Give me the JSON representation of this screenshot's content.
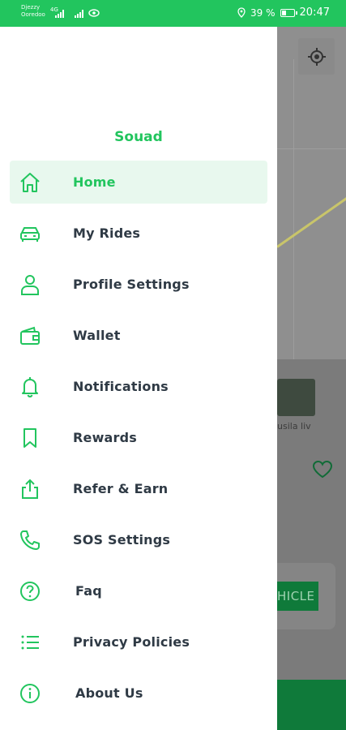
{
  "status_bar": {
    "carrier_line1": "Djezzy",
    "carrier_line2": "Ooredoo",
    "signal_label": "4G",
    "battery_text": "39 %",
    "battery_level": 0.39,
    "time": "20:47"
  },
  "colors": {
    "accent": "#22c55e",
    "active_bg": "#e8f8ee",
    "label_text": "#2f3a45",
    "dark_green": "#0f7a3a"
  },
  "drawer": {
    "user_name": "Souad",
    "items": [
      {
        "label": "Home",
        "icon": "home-icon",
        "active": true
      },
      {
        "label": "My Rides",
        "icon": "car-icon",
        "active": false
      },
      {
        "label": "Profile Settings",
        "icon": "user-icon",
        "active": false
      },
      {
        "label": "Wallet",
        "icon": "wallet-icon",
        "active": false
      },
      {
        "label": "Notifications",
        "icon": "bell-icon",
        "active": false
      },
      {
        "label": "Rewards",
        "icon": "bookmark-icon",
        "active": false
      },
      {
        "label": "Refer & Earn",
        "icon": "share-icon",
        "active": false
      },
      {
        "label": "SOS Settings",
        "icon": "phone-icon",
        "active": false
      },
      {
        "label": "Faq",
        "icon": "help-circle-icon",
        "active": false
      },
      {
        "label": "Privacy Policies",
        "icon": "list-icon",
        "active": false
      },
      {
        "label": "About Us",
        "icon": "info-icon",
        "active": false
      }
    ]
  },
  "background": {
    "thumbnail_label": "usila liv",
    "vehicle_button_label": "HICLE",
    "location_icon": "crosshair-icon",
    "favorite_icon": "heart-icon"
  }
}
